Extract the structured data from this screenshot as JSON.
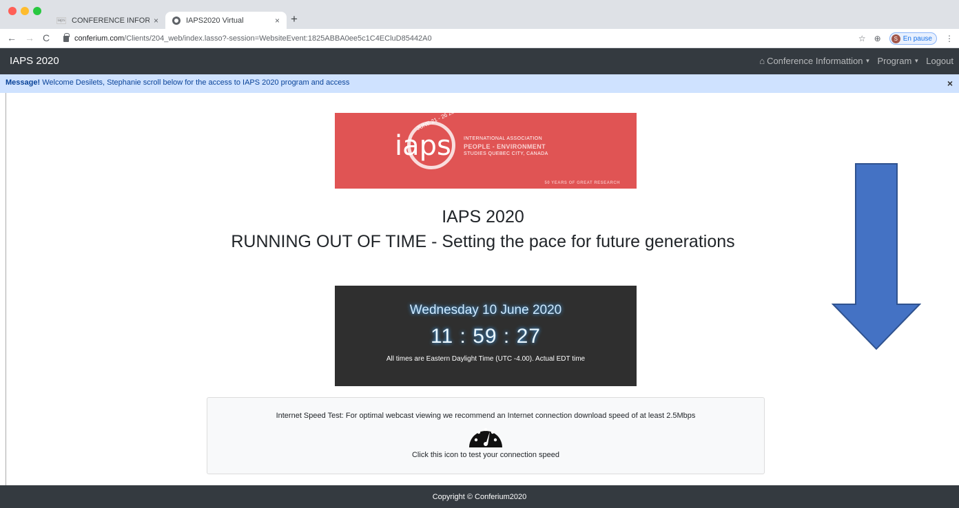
{
  "browser": {
    "tabs": [
      {
        "title": "CONFERENCE INFORMATION |",
        "favicon_text": "iaps",
        "active": false
      },
      {
        "title": "IAPS2020 Virtual",
        "active": true
      }
    ],
    "close_glyph": "×",
    "new_tab_glyph": "+",
    "url_host": "conferium.com",
    "url_path": "/Clients/204_web/index.lasso?-session=WebsiteEvent:1825ABBA0ee5c1C4ECluD85442A0",
    "profile_initial": "S",
    "profile_label": "En pause",
    "icons": [
      "back-arrow-icon",
      "forward-arrow-icon",
      "reload-icon",
      "lock-icon",
      "star-icon",
      "extension-icon",
      "menu-dots-icon"
    ]
  },
  "site": {
    "brand": "IAPS 2020",
    "nav": [
      {
        "label": "Conference Informattion",
        "icon": "home-icon",
        "dropdown": true
      },
      {
        "label": "Program",
        "dropdown": true
      },
      {
        "label": "Logout",
        "dropdown": false
      }
    ]
  },
  "alert": {
    "strong": "Message!",
    "text": " Welcome Desilets, Stephanie scroll below for the access to IAPS 2020 program and access",
    "close": "×"
  },
  "banner": {
    "letters": "iaps",
    "dates": "JUNE 21 - 26 2020",
    "line1": "INTERNATIONAL ASSOCIATION",
    "line2": "PEOPLE - ENVIRONMENT",
    "line3": "STUDIES  QUEBEC CITY, CANADA",
    "tagline": "50 YEARS OF GREAT RESEARCH",
    "color": "#e05454"
  },
  "titles": {
    "line1": "IAPS 2020",
    "line2": "RUNNING OUT OF TIME - Setting the pace for future generations"
  },
  "clock": {
    "date": "Wednesday 10 June 2020",
    "time": "11 : 59 : 27",
    "note": "All times are Eastern Daylight Time (UTC -4.00). Actual EDT time"
  },
  "speed_test": {
    "message": "Internet Speed Test: For optimal webcast viewing we recommend an Internet connection download speed of at least 2.5Mbps",
    "cta": "Click this icon to test your connection speed",
    "icon": "speedometer-icon"
  },
  "arrow": {
    "icon": "down-arrow-icon",
    "color": "#4472c4"
  },
  "footer": {
    "text": "Copyright © Conferium2020"
  }
}
